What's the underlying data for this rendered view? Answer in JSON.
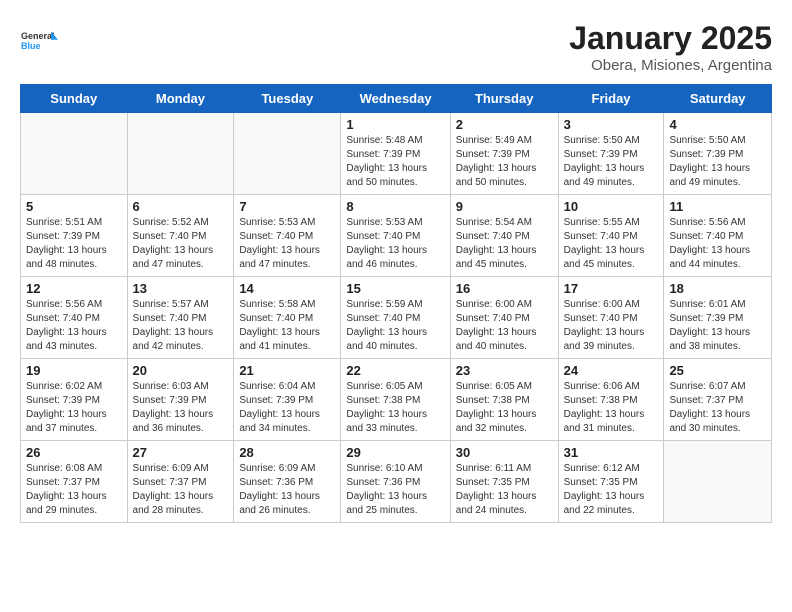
{
  "header": {
    "logo_line1": "General",
    "logo_line2": "Blue",
    "month": "January 2025",
    "location": "Obera, Misiones, Argentina"
  },
  "weekdays": [
    "Sunday",
    "Monday",
    "Tuesday",
    "Wednesday",
    "Thursday",
    "Friday",
    "Saturday"
  ],
  "weeks": [
    [
      {
        "day": "",
        "info": ""
      },
      {
        "day": "",
        "info": ""
      },
      {
        "day": "",
        "info": ""
      },
      {
        "day": "1",
        "info": "Sunrise: 5:48 AM\nSunset: 7:39 PM\nDaylight: 13 hours\nand 50 minutes."
      },
      {
        "day": "2",
        "info": "Sunrise: 5:49 AM\nSunset: 7:39 PM\nDaylight: 13 hours\nand 50 minutes."
      },
      {
        "day": "3",
        "info": "Sunrise: 5:50 AM\nSunset: 7:39 PM\nDaylight: 13 hours\nand 49 minutes."
      },
      {
        "day": "4",
        "info": "Sunrise: 5:50 AM\nSunset: 7:39 PM\nDaylight: 13 hours\nand 49 minutes."
      }
    ],
    [
      {
        "day": "5",
        "info": "Sunrise: 5:51 AM\nSunset: 7:39 PM\nDaylight: 13 hours\nand 48 minutes."
      },
      {
        "day": "6",
        "info": "Sunrise: 5:52 AM\nSunset: 7:40 PM\nDaylight: 13 hours\nand 47 minutes."
      },
      {
        "day": "7",
        "info": "Sunrise: 5:53 AM\nSunset: 7:40 PM\nDaylight: 13 hours\nand 47 minutes."
      },
      {
        "day": "8",
        "info": "Sunrise: 5:53 AM\nSunset: 7:40 PM\nDaylight: 13 hours\nand 46 minutes."
      },
      {
        "day": "9",
        "info": "Sunrise: 5:54 AM\nSunset: 7:40 PM\nDaylight: 13 hours\nand 45 minutes."
      },
      {
        "day": "10",
        "info": "Sunrise: 5:55 AM\nSunset: 7:40 PM\nDaylight: 13 hours\nand 45 minutes."
      },
      {
        "day": "11",
        "info": "Sunrise: 5:56 AM\nSunset: 7:40 PM\nDaylight: 13 hours\nand 44 minutes."
      }
    ],
    [
      {
        "day": "12",
        "info": "Sunrise: 5:56 AM\nSunset: 7:40 PM\nDaylight: 13 hours\nand 43 minutes."
      },
      {
        "day": "13",
        "info": "Sunrise: 5:57 AM\nSunset: 7:40 PM\nDaylight: 13 hours\nand 42 minutes."
      },
      {
        "day": "14",
        "info": "Sunrise: 5:58 AM\nSunset: 7:40 PM\nDaylight: 13 hours\nand 41 minutes."
      },
      {
        "day": "15",
        "info": "Sunrise: 5:59 AM\nSunset: 7:40 PM\nDaylight: 13 hours\nand 40 minutes."
      },
      {
        "day": "16",
        "info": "Sunrise: 6:00 AM\nSunset: 7:40 PM\nDaylight: 13 hours\nand 40 minutes."
      },
      {
        "day": "17",
        "info": "Sunrise: 6:00 AM\nSunset: 7:40 PM\nDaylight: 13 hours\nand 39 minutes."
      },
      {
        "day": "18",
        "info": "Sunrise: 6:01 AM\nSunset: 7:39 PM\nDaylight: 13 hours\nand 38 minutes."
      }
    ],
    [
      {
        "day": "19",
        "info": "Sunrise: 6:02 AM\nSunset: 7:39 PM\nDaylight: 13 hours\nand 37 minutes."
      },
      {
        "day": "20",
        "info": "Sunrise: 6:03 AM\nSunset: 7:39 PM\nDaylight: 13 hours\nand 36 minutes."
      },
      {
        "day": "21",
        "info": "Sunrise: 6:04 AM\nSunset: 7:39 PM\nDaylight: 13 hours\nand 34 minutes."
      },
      {
        "day": "22",
        "info": "Sunrise: 6:05 AM\nSunset: 7:38 PM\nDaylight: 13 hours\nand 33 minutes."
      },
      {
        "day": "23",
        "info": "Sunrise: 6:05 AM\nSunset: 7:38 PM\nDaylight: 13 hours\nand 32 minutes."
      },
      {
        "day": "24",
        "info": "Sunrise: 6:06 AM\nSunset: 7:38 PM\nDaylight: 13 hours\nand 31 minutes."
      },
      {
        "day": "25",
        "info": "Sunrise: 6:07 AM\nSunset: 7:37 PM\nDaylight: 13 hours\nand 30 minutes."
      }
    ],
    [
      {
        "day": "26",
        "info": "Sunrise: 6:08 AM\nSunset: 7:37 PM\nDaylight: 13 hours\nand 29 minutes."
      },
      {
        "day": "27",
        "info": "Sunrise: 6:09 AM\nSunset: 7:37 PM\nDaylight: 13 hours\nand 28 minutes."
      },
      {
        "day": "28",
        "info": "Sunrise: 6:09 AM\nSunset: 7:36 PM\nDaylight: 13 hours\nand 26 minutes."
      },
      {
        "day": "29",
        "info": "Sunrise: 6:10 AM\nSunset: 7:36 PM\nDaylight: 13 hours\nand 25 minutes."
      },
      {
        "day": "30",
        "info": "Sunrise: 6:11 AM\nSunset: 7:35 PM\nDaylight: 13 hours\nand 24 minutes."
      },
      {
        "day": "31",
        "info": "Sunrise: 6:12 AM\nSunset: 7:35 PM\nDaylight: 13 hours\nand 22 minutes."
      },
      {
        "day": "",
        "info": ""
      }
    ]
  ]
}
